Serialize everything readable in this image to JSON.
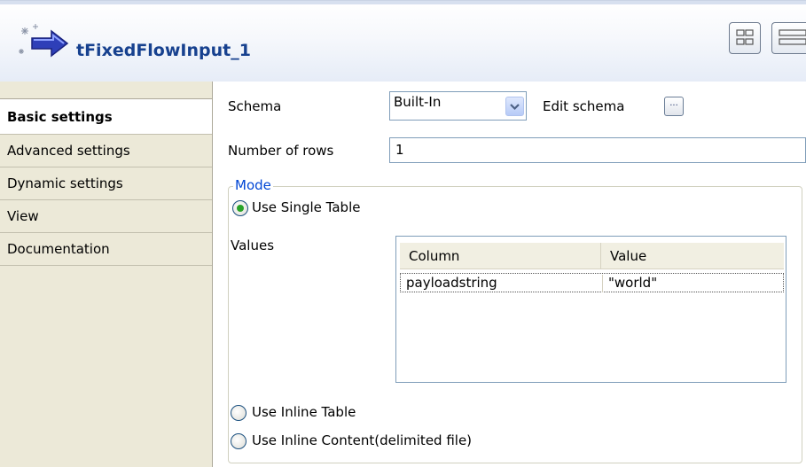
{
  "header": {
    "title": "tFixedFlowInput_1",
    "component_icon": "component-arrow-icon",
    "view_buttons": [
      "grid-view-icon",
      "list-view-icon"
    ]
  },
  "tabs": [
    {
      "label": "Basic settings",
      "active": true
    },
    {
      "label": "Advanced settings",
      "active": false
    },
    {
      "label": "Dynamic settings",
      "active": false
    },
    {
      "label": "View",
      "active": false
    },
    {
      "label": "Documentation",
      "active": false
    }
  ],
  "form": {
    "schema_label": "Schema",
    "schema_value": "Built-In",
    "edit_schema_label": "Edit schema",
    "edit_schema_button": "...",
    "rows_label": "Number of rows",
    "rows_value": "1",
    "mode_legend": "Mode",
    "single_table_label": "Use Single Table",
    "values_label": "Values",
    "inline_table_label": "Use Inline Table",
    "inline_content_label": "Use Inline Content(delimited file)",
    "selected_mode": "single_table"
  },
  "values_table": {
    "columns": [
      "Column",
      "Value"
    ],
    "rows": [
      [
        "payloadstring",
        "\"world\""
      ]
    ]
  },
  "colors": {
    "title": "#17418f",
    "legend": "#0046d5",
    "radio_selected": "#29a329",
    "tab_background": "#ece9d8"
  }
}
